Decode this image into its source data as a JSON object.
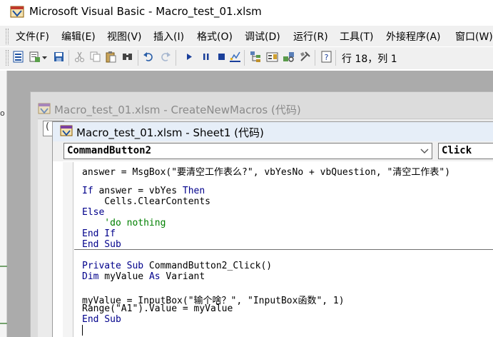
{
  "app": {
    "title": "Microsoft Visual Basic - Macro_test_01.xlsm"
  },
  "menu": {
    "items": [
      {
        "label": "文件(F)"
      },
      {
        "label": "编辑(E)"
      },
      {
        "label": "视图(V)"
      },
      {
        "label": "插入(I)"
      },
      {
        "label": "格式(O)"
      },
      {
        "label": "调试(D)"
      },
      {
        "label": "运行(R)"
      },
      {
        "label": "工具(T)"
      },
      {
        "label": "外接程序(A)"
      },
      {
        "label": "窗口(W)"
      }
    ]
  },
  "toolbar": {
    "status": "行 18，列 1",
    "icons": [
      "view-excel-icon",
      "insert-module-icon",
      "save-icon",
      "cut-icon",
      "copy-icon",
      "paste-icon",
      "find-icon",
      "undo-icon",
      "redo-icon",
      "run-icon",
      "break-icon",
      "reset-icon",
      "design-mode-icon",
      "project-explorer-icon",
      "properties-icon",
      "object-browser-icon",
      "toolbox-icon",
      "help-icon"
    ]
  },
  "back_window": {
    "title": "Macro_test_01.xlsm - CreateNewMacros (代码)",
    "combo_value": "("
  },
  "front_window": {
    "title": "Macro_test_01.xlsm - Sheet1 (代码)",
    "object_combo": "CommandButton2",
    "procedure_combo": "Click"
  },
  "code": {
    "lines": [
      "answer = MsgBox(\"要清空工作表么?\", vbYesNo + vbQuestion, \"清空工作表\")",
      "",
      "If answer = vbYes Then",
      "    Cells.ClearContents",
      "Else",
      "    'do nothing",
      "End If",
      "End Sub",
      "",
      "Private Sub CommandButton2_Click()",
      "Dim myValue As Variant",
      "",
      "myValue = InputBox(\"输个啥？\", \"InputBox函数\", 1)",
      "Range(\"A1\").Value = myValue",
      "End Sub"
    ]
  },
  "left_strip": {
    "label": "o"
  }
}
